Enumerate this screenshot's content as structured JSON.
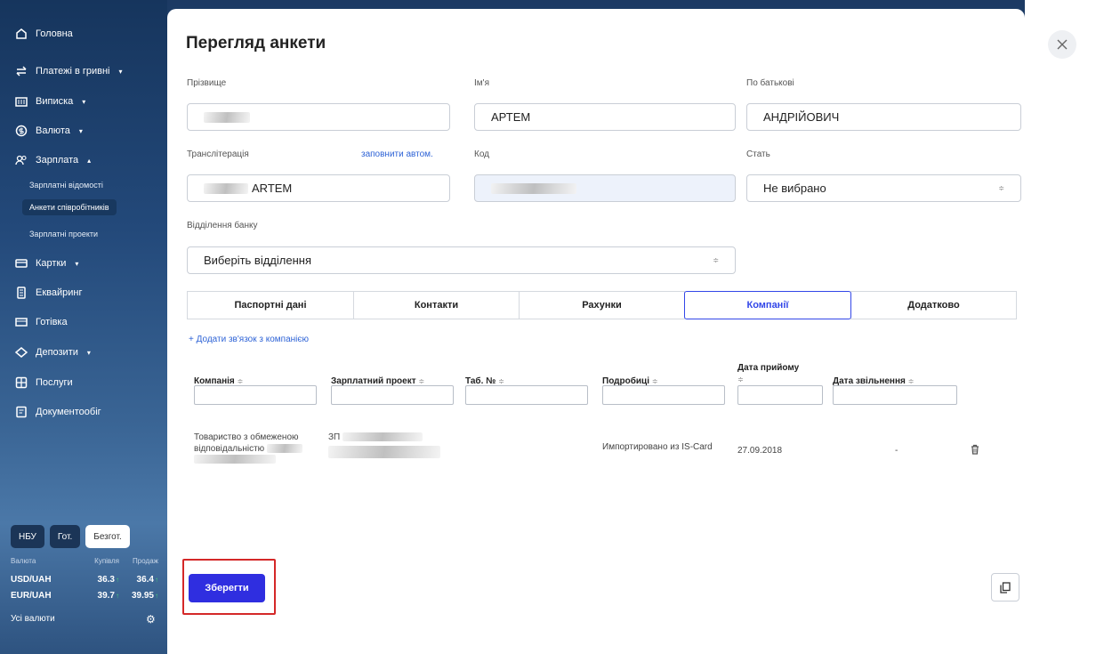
{
  "sidebar": {
    "items": [
      {
        "label": "Головна",
        "icon": "home-icon",
        "caret": ""
      },
      {
        "label": "Платежі в гривні",
        "icon": "transfer-icon",
        "caret": "▾"
      },
      {
        "label": "Виписка",
        "icon": "statement-icon",
        "caret": "▾"
      },
      {
        "label": "Валюта",
        "icon": "currency-icon",
        "caret": "▾"
      },
      {
        "label": "Зарплата",
        "icon": "people-icon",
        "caret": "▴"
      },
      {
        "label": "Картки",
        "icon": "card-icon",
        "caret": "▾"
      },
      {
        "label": "Еквайринг",
        "icon": "terminal-icon",
        "caret": ""
      },
      {
        "label": "Готівка",
        "icon": "cash-icon",
        "caret": ""
      },
      {
        "label": "Депозити",
        "icon": "deposit-icon",
        "caret": "▾"
      },
      {
        "label": "Послуги",
        "icon": "services-icon",
        "caret": ""
      },
      {
        "label": "Документообіг",
        "icon": "document-icon",
        "caret": ""
      }
    ],
    "subitems": [
      "Зарплатні відомості",
      "Анкети співробітників",
      "Зарплатні проекти"
    ],
    "rates": {
      "tabs": [
        "НБУ",
        "Гот.",
        "Безгот."
      ],
      "head": {
        "currency": "Валюта",
        "buy": "Купівля",
        "sell": "Продаж"
      },
      "rows": [
        {
          "pair": "USD/UAH",
          "buy": "36.3",
          "sell": "36.4"
        },
        {
          "pair": "EUR/UAH",
          "buy": "39.7",
          "sell": "39.95"
        }
      ],
      "up_arrow": "↑",
      "all_label": "Усі валюти"
    }
  },
  "form": {
    "title": "Перегляд анкети",
    "labels": {
      "surname": "Прізвище",
      "name": "Ім'я",
      "patronymic": "По батькові",
      "translit": "Транслітерація",
      "autofill": "заповнити автом.",
      "code": "Код",
      "gender": "Стать",
      "branch": "Відділення банку"
    },
    "values": {
      "name": "АРТЕМ",
      "patronymic": "АНДРІЙОВИЧ",
      "translit": "ARTEM",
      "gender": "Не вибрано",
      "branch": "Виберіть відділення"
    }
  },
  "tabs": [
    "Паспортні дані",
    "Контакти",
    "Рахунки",
    "Компанії",
    "Додатково"
  ],
  "active_tab": "Компанії",
  "companies": {
    "add_link": "+ Додати зв'язок з компанією",
    "sort_glyph": "≑",
    "columns": [
      "Компанія",
      "Зарплатний проект",
      "Таб. №",
      "Подробиці",
      "Дата прийому",
      "Дата звільнення"
    ],
    "row": {
      "company_line1": "Товариство з обмеженою",
      "company_line2": "відповідальністю",
      "project_prefix": "ЗП",
      "details": "Импортировано из IS-Card",
      "hire_date": "27.09.2018",
      "fire_date": "-"
    }
  },
  "actions": {
    "save": "Зберегти"
  },
  "colors": {
    "primary": "#2f2ee0",
    "active_tab": "#3347e8",
    "link": "#2e63d6",
    "highlight": "#d42828"
  }
}
